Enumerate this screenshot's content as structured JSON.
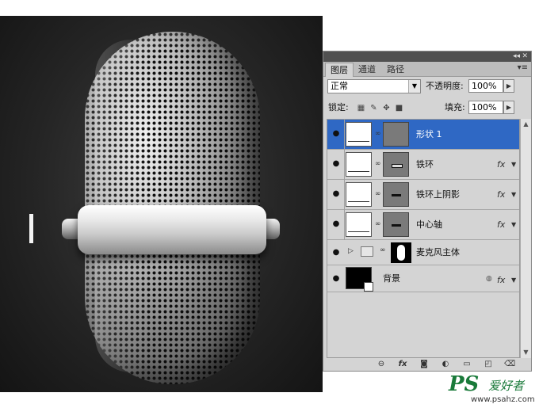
{
  "canvas": {
    "background": "#2b2b2b"
  },
  "panel": {
    "tabs": [
      {
        "label": "图层",
        "active": true
      },
      {
        "label": "通道",
        "active": false
      },
      {
        "label": "路径",
        "active": false
      }
    ],
    "header_icons": {
      "collapse": "◂◂",
      "close": "✕",
      "menu": "▾≡"
    },
    "blend_mode": "正常",
    "opacity_label": "不透明度:",
    "opacity_value": "100%",
    "lock_label": "锁定:",
    "fill_label": "填充:",
    "fill_value": "100%",
    "selected_color": "#2f68c4",
    "layers": [
      {
        "name": "形状 1",
        "selected": true,
        "has_fx": false
      },
      {
        "name": "铁环",
        "selected": false,
        "has_fx": true
      },
      {
        "name": "铁环上阴影",
        "selected": false,
        "has_fx": true
      },
      {
        "name": "中心轴",
        "selected": false,
        "has_fx": true
      }
    ],
    "group": {
      "name": "麦克风主体"
    },
    "background_layer": {
      "name": "背景",
      "fx": "fx"
    },
    "fx_label": "fx"
  },
  "watermark": {
    "logo": "PS",
    "text": "爱好者",
    "url": "www.psahz.com"
  }
}
